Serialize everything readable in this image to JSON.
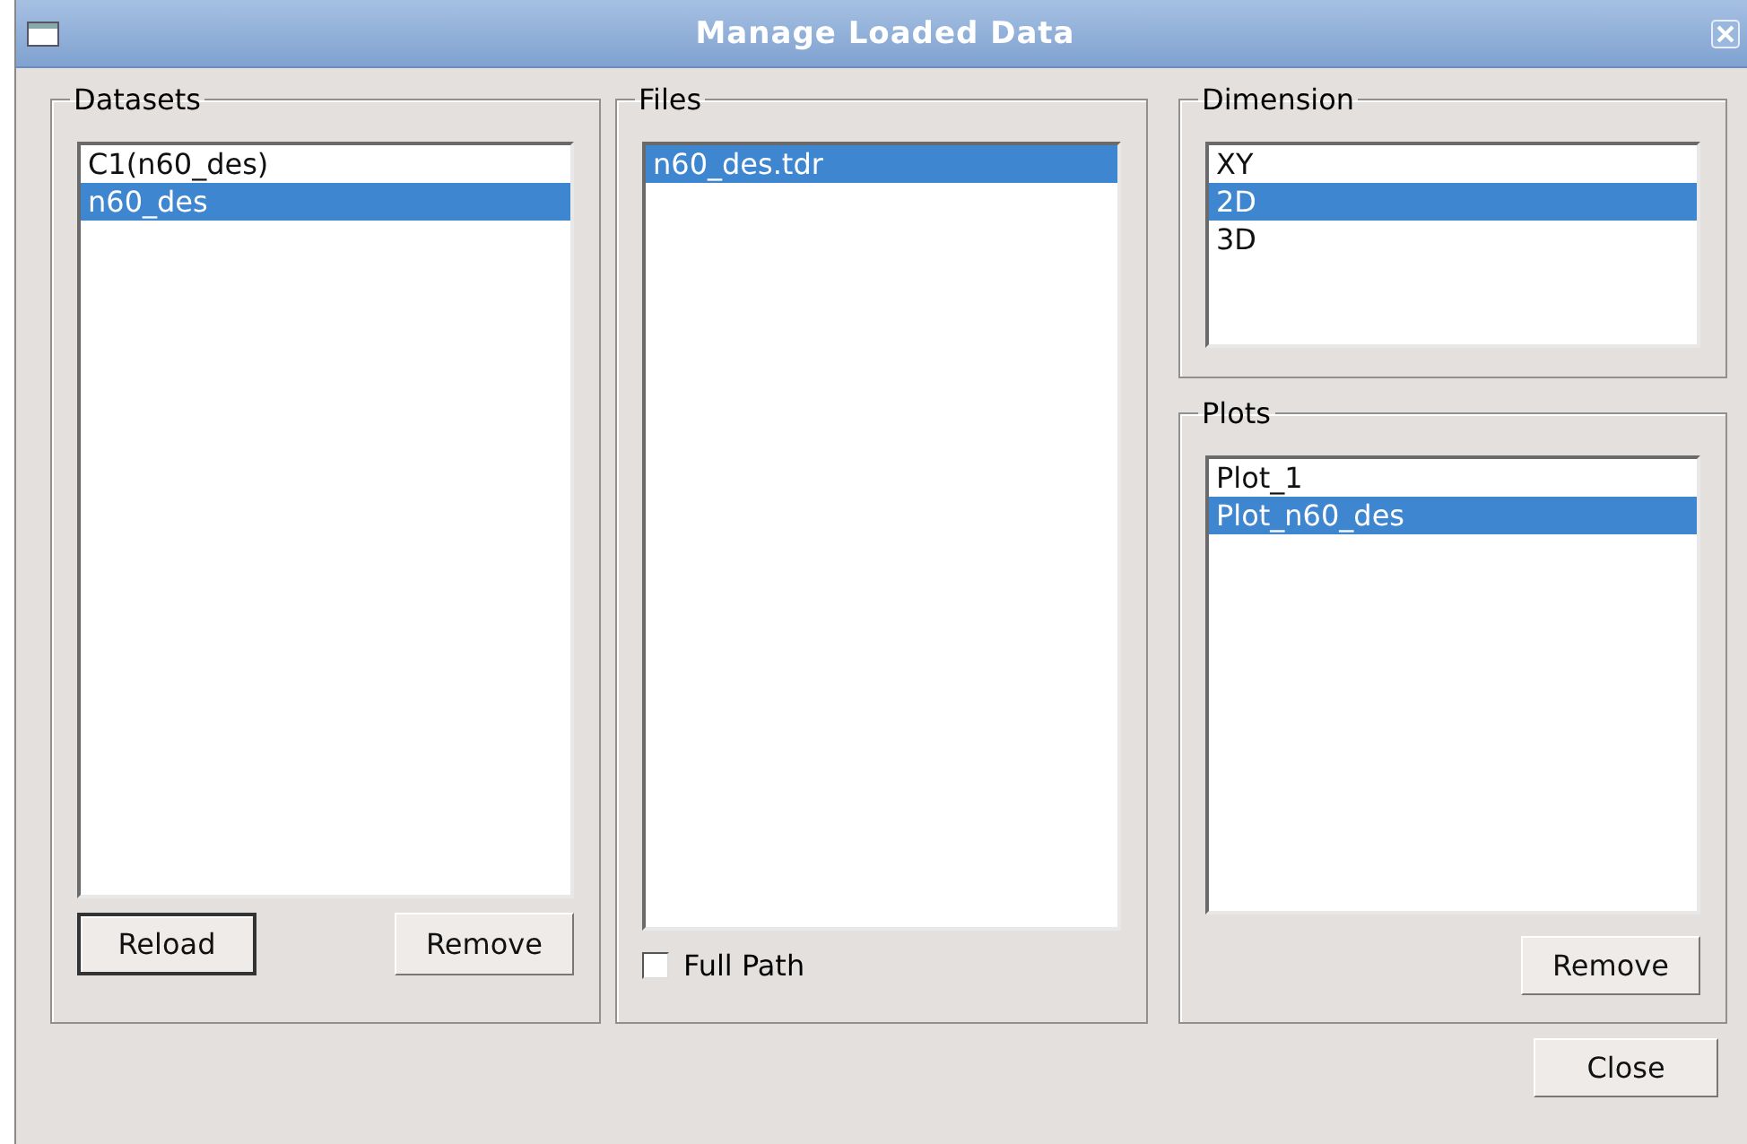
{
  "window": {
    "title": "Manage Loaded Data"
  },
  "datasets": {
    "title": "Datasets",
    "items": [
      {
        "label": "C1(n60_des)",
        "selected": false
      },
      {
        "label": "n60_des",
        "selected": true
      }
    ],
    "buttons": [
      {
        "label": "Reload",
        "default": true
      },
      {
        "label": "Remove",
        "default": false
      }
    ]
  },
  "files": {
    "title": "Files",
    "items": [
      {
        "label": "n60_des.tdr",
        "selected": true
      }
    ],
    "full_path": {
      "label": "Full Path",
      "checked": false
    }
  },
  "dimension": {
    "title": "Dimension",
    "items": [
      {
        "label": "XY",
        "selected": false
      },
      {
        "label": "2D",
        "selected": true
      },
      {
        "label": "3D",
        "selected": false
      }
    ]
  },
  "plots": {
    "title": "Plots",
    "items": [
      {
        "label": "Plot_1",
        "selected": false
      },
      {
        "label": "Plot_n60_des",
        "selected": true
      }
    ],
    "buttons": [
      {
        "label": "Remove",
        "default": false
      }
    ]
  },
  "footer_buttons": [
    {
      "label": "Close",
      "default": false
    }
  ]
}
